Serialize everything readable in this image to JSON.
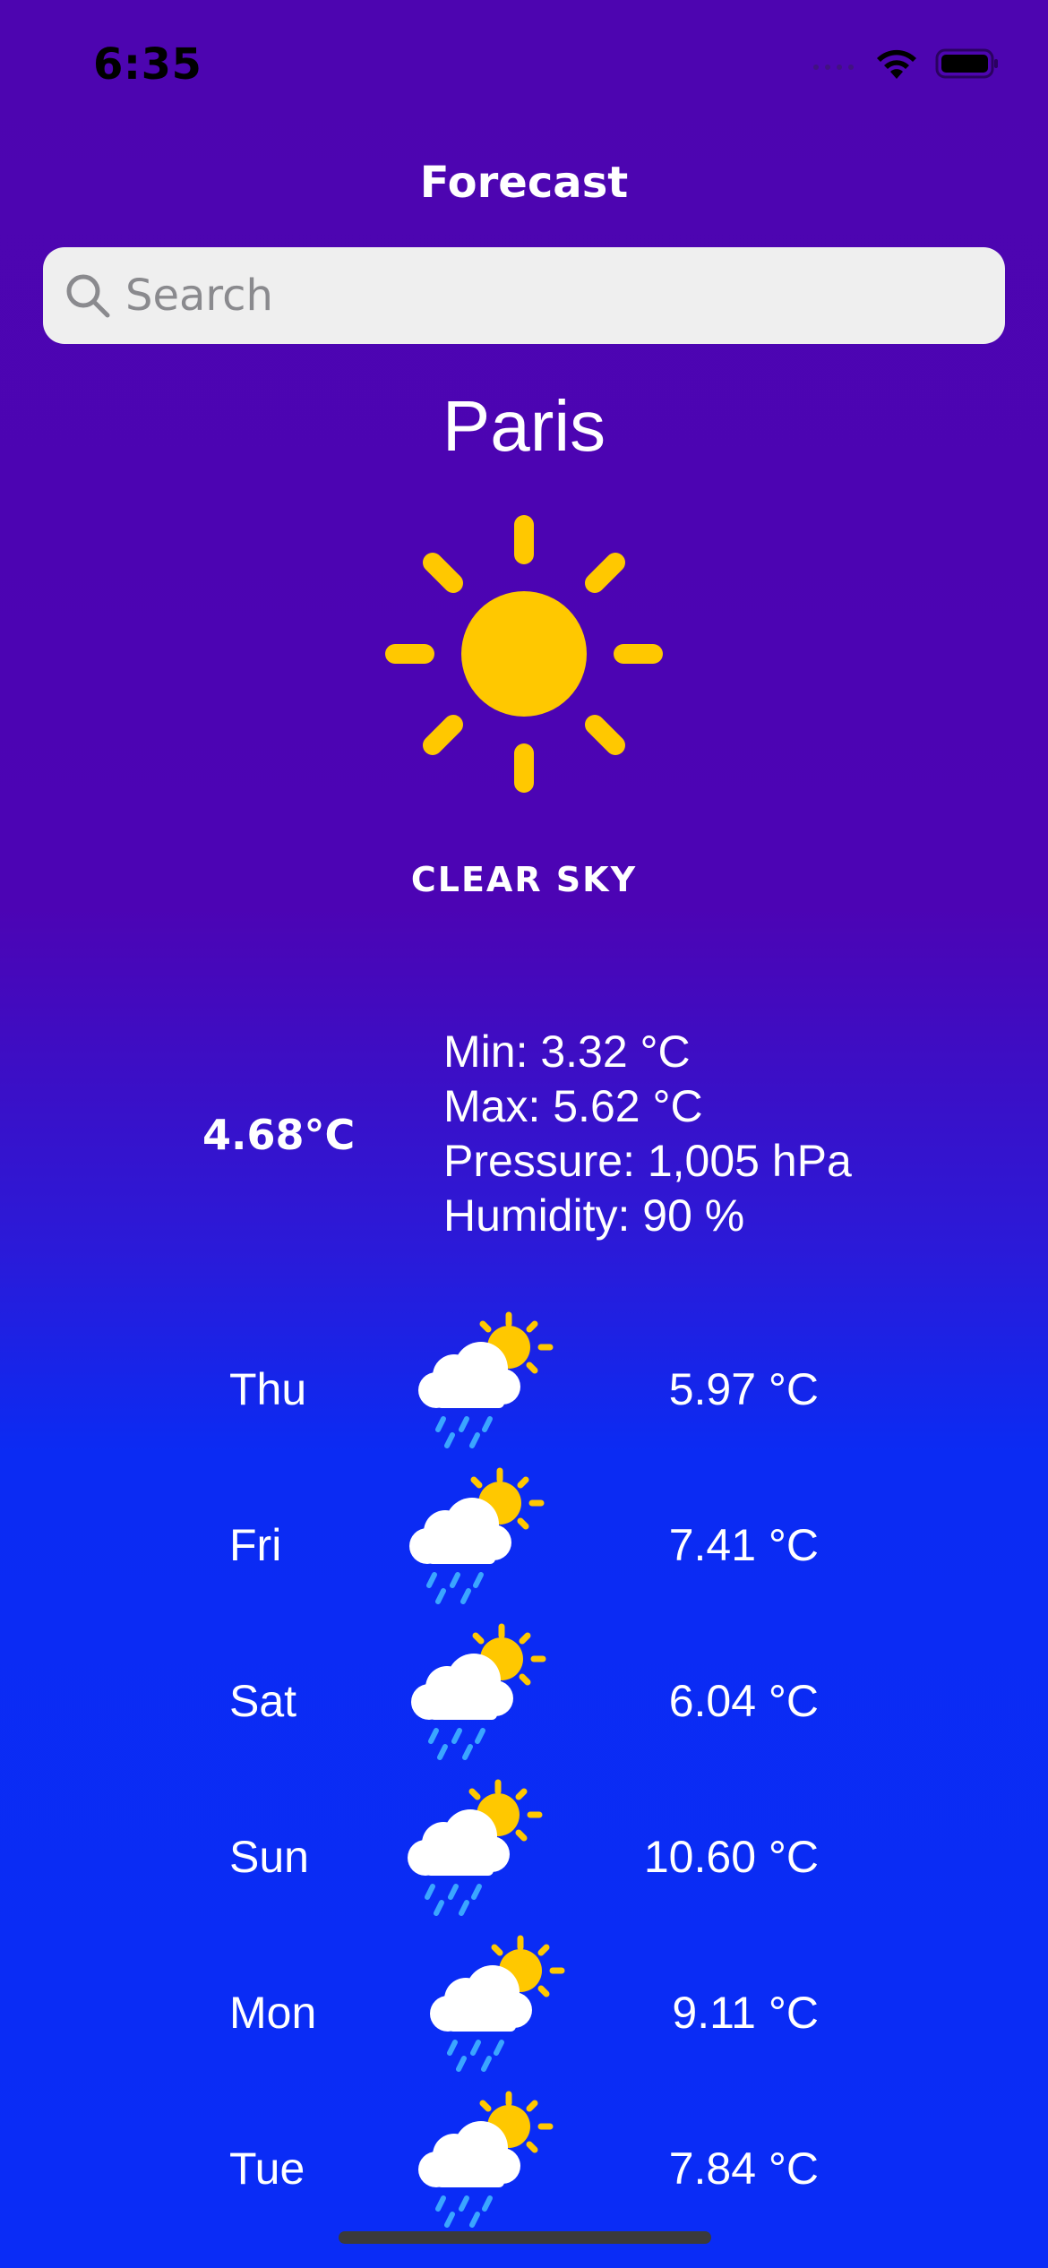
{
  "status_bar": {
    "time": "6:35"
  },
  "nav": {
    "title": "Forecast"
  },
  "search": {
    "placeholder": "Search",
    "icon": "search-icon"
  },
  "current": {
    "city": "Paris",
    "icon": "sun-icon",
    "condition": "CLEAR SKY",
    "temperature": "4.68°C",
    "min": "Min: 3.32 °C",
    "max": "Max: 5.62 °C",
    "pressure": "Pressure: 1,005 hPa",
    "humidity": "Humidity: 90 %"
  },
  "forecast": [
    {
      "day": "Thu",
      "temp": "5.97 °C",
      "icon": "sun-cloud-rain-icon"
    },
    {
      "day": "Fri",
      "temp": "7.41 °C",
      "icon": "sun-cloud-rain-icon"
    },
    {
      "day": "Sat",
      "temp": "6.04 °C",
      "icon": "sun-cloud-rain-icon"
    },
    {
      "day": "Sun",
      "temp": "10.60 °C",
      "icon": "sun-cloud-rain-icon"
    },
    {
      "day": "Mon",
      "temp": "9.11 °C",
      "icon": "sun-cloud-rain-icon"
    },
    {
      "day": "Tue",
      "temp": "7.84 °C",
      "icon": "sun-cloud-rain-icon"
    }
  ],
  "colors": {
    "background_top": "#4d05b0",
    "background_bottom": "#0a2cf6",
    "sun": "#ffc800",
    "rain": "#3aa6ff",
    "cloud": "#ffffff"
  }
}
